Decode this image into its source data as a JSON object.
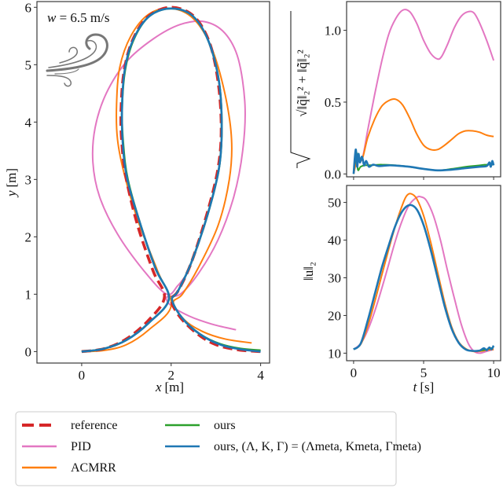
{
  "chart_data": [
    {
      "id": "trajectory",
      "type": "line",
      "title": "",
      "xlabel": "x [m]",
      "ylabel": "y [m]",
      "xlim": [
        -1.0,
        4.2
      ],
      "ylim": [
        -0.2,
        6.1
      ],
      "xticks": [
        0,
        2,
        4
      ],
      "yticks": [
        0,
        1,
        2,
        3,
        4,
        5,
        6
      ],
      "grid": false,
      "annotation": "w = 6.5 m/s",
      "annotation_icon": "wind-icon",
      "series": [
        {
          "name": "reference",
          "color": "#d62728",
          "dash": true,
          "x": [
            0.0,
            0.5,
            1.0,
            1.5,
            1.85,
            1.6,
            1.25,
            1.0,
            0.9,
            0.88,
            0.95,
            1.15,
            1.5,
            2.0,
            2.5,
            2.85,
            3.05,
            3.12,
            3.05,
            2.8,
            2.45,
            2.15,
            2.0,
            2.2,
            2.6,
            3.0,
            3.5,
            4.0
          ],
          "y": [
            0.0,
            0.05,
            0.22,
            0.55,
            0.95,
            1.4,
            2.2,
            3.0,
            3.6,
            4.2,
            4.9,
            5.45,
            5.85,
            6.0,
            5.85,
            5.4,
            4.7,
            3.9,
            3.2,
            2.4,
            1.55,
            1.05,
            0.9,
            0.6,
            0.3,
            0.12,
            0.03,
            0.0
          ]
        },
        {
          "name": "PID",
          "color": "#e377c2",
          "dash": false,
          "x": [
            2.35,
            2.15,
            1.9,
            1.4,
            0.8,
            0.4,
            0.25,
            0.3,
            0.55,
            1.0,
            1.6,
            2.2,
            2.75,
            3.2,
            3.5,
            3.65,
            3.6,
            3.4,
            3.05,
            2.6,
            2.2,
            1.9,
            2.0,
            2.4,
            2.9,
            3.45
          ],
          "y": [
            1.35,
            1.15,
            1.0,
            1.4,
            2.05,
            2.7,
            3.3,
            3.9,
            4.5,
            5.05,
            5.45,
            5.7,
            5.75,
            5.55,
            5.1,
            4.3,
            3.5,
            2.7,
            1.95,
            1.35,
            1.0,
            0.95,
            0.8,
            0.62,
            0.48,
            0.38
          ]
        },
        {
          "name": "ACMRR",
          "color": "#ff7f0e",
          "dash": false,
          "x": [
            0.0,
            0.5,
            1.0,
            1.5,
            2.0,
            1.7,
            1.25,
            0.95,
            0.8,
            0.78,
            0.85,
            1.1,
            1.5,
            2.0,
            2.5,
            2.9,
            3.2,
            3.35,
            3.3,
            3.05,
            2.6,
            2.25,
            2.05,
            2.3,
            2.7,
            3.2,
            3.8
          ],
          "y": [
            0.0,
            0.02,
            0.12,
            0.38,
            0.8,
            1.4,
            2.3,
            3.1,
            3.7,
            4.3,
            4.95,
            5.5,
            5.88,
            5.98,
            5.8,
            5.3,
            4.5,
            3.7,
            3.0,
            2.2,
            1.45,
            1.0,
            0.85,
            0.55,
            0.35,
            0.22,
            0.15
          ]
        },
        {
          "name": "ours",
          "color": "#2ca02c",
          "dash": false,
          "x": [
            0.0,
            0.5,
            1.0,
            1.5,
            1.95,
            1.65,
            1.3,
            1.03,
            0.93,
            0.9,
            0.97,
            1.17,
            1.52,
            2.0,
            2.48,
            2.84,
            3.07,
            3.13,
            3.07,
            2.82,
            2.45,
            2.15,
            2.02,
            2.25,
            2.65,
            3.1,
            3.55,
            4.0
          ],
          "y": [
            0.0,
            0.05,
            0.2,
            0.5,
            0.92,
            1.45,
            2.25,
            3.0,
            3.6,
            4.2,
            4.9,
            5.45,
            5.85,
            5.98,
            5.85,
            5.4,
            4.7,
            3.9,
            3.2,
            2.4,
            1.55,
            1.05,
            0.9,
            0.58,
            0.3,
            0.13,
            0.05,
            0.02
          ]
        },
        {
          "name": "ours, (Λ, K, Γ) = (Λmeta, Kmeta, Γmeta)",
          "color": "#1f77b4",
          "dash": false,
          "x": [
            0.0,
            0.5,
            1.0,
            1.5,
            1.95,
            1.65,
            1.3,
            1.02,
            0.92,
            0.9,
            0.96,
            1.16,
            1.52,
            2.0,
            2.48,
            2.84,
            3.07,
            3.13,
            3.07,
            2.82,
            2.45,
            2.15,
            2.02,
            2.25,
            2.65,
            3.1,
            3.55,
            4.0
          ],
          "y": [
            0.0,
            0.05,
            0.2,
            0.5,
            0.92,
            1.45,
            2.25,
            3.0,
            3.6,
            4.2,
            4.9,
            5.45,
            5.85,
            5.98,
            5.85,
            5.4,
            4.7,
            3.9,
            3.2,
            2.4,
            1.55,
            1.05,
            0.9,
            0.58,
            0.3,
            0.12,
            0.04,
            0.0
          ]
        }
      ]
    },
    {
      "id": "tracking-error",
      "type": "line",
      "xlabel": "",
      "ylabel": "√(‖q̃‖₂² + ‖q̃̇‖₂²)",
      "xlim": [
        -0.5,
        10.5
      ],
      "ylim": [
        -0.02,
        1.2
      ],
      "xticks": [
        0,
        5,
        10
      ],
      "xticklabels_visible": false,
      "yticks": [
        0.0,
        0.5,
        1.0
      ],
      "yticklabels": [
        "0.0",
        "0.5",
        "1.0"
      ],
      "grid": false,
      "series": [
        {
          "name": "PID",
          "color": "#e377c2",
          "x": [
            0.0,
            0.3,
            0.6,
            1.0,
            1.5,
            2.0,
            2.5,
            3.0,
            3.5,
            4.0,
            4.5,
            5.0,
            5.5,
            6.0,
            6.3,
            6.7,
            7.2,
            7.7,
            8.2,
            8.6,
            9.0,
            9.5,
            10.0
          ],
          "y": [
            0.0,
            0.12,
            0.1,
            0.3,
            0.55,
            0.78,
            0.97,
            1.08,
            1.14,
            1.13,
            1.05,
            0.93,
            0.84,
            0.8,
            0.82,
            0.9,
            1.02,
            1.1,
            1.13,
            1.12,
            1.05,
            0.93,
            0.79
          ]
        },
        {
          "name": "ACMRR",
          "color": "#ff7f0e",
          "x": [
            0.0,
            0.3,
            0.6,
            1.0,
            1.5,
            2.0,
            2.5,
            3.0,
            3.5,
            4.0,
            4.5,
            5.0,
            5.5,
            6.0,
            6.5,
            7.0,
            7.5,
            8.0,
            8.5,
            9.0,
            9.5,
            10.0
          ],
          "y": [
            0.0,
            0.12,
            0.1,
            0.25,
            0.38,
            0.47,
            0.51,
            0.52,
            0.48,
            0.39,
            0.28,
            0.2,
            0.17,
            0.17,
            0.2,
            0.24,
            0.28,
            0.3,
            0.3,
            0.29,
            0.27,
            0.26
          ]
        },
        {
          "name": "ours",
          "color": "#2ca02c",
          "x": [
            0.0,
            0.2,
            0.3,
            0.5,
            0.8,
            1.0,
            1.5,
            2.0,
            3.0,
            4.0,
            5.0,
            6.0,
            7.0,
            8.0,
            9.0,
            9.5,
            10.0
          ],
          "y": [
            0.0,
            0.15,
            0.03,
            0.05,
            0.06,
            0.06,
            0.062,
            0.065,
            0.06,
            0.05,
            0.035,
            0.025,
            0.035,
            0.05,
            0.06,
            0.065,
            0.065
          ]
        },
        {
          "name": "ours, (Λ, K, Γ) = (Λmeta, Kmeta, Γmeta)",
          "color": "#1f77b4",
          "x": [
            0.0,
            0.15,
            0.25,
            0.35,
            0.45,
            0.6,
            0.75,
            0.9,
            1.1,
            1.4,
            1.8,
            2.5,
            3.0,
            4.0,
            5.0,
            6.0,
            7.0,
            8.0,
            9.0,
            9.5,
            9.7,
            9.8,
            9.9,
            10.0
          ],
          "y": [
            0.0,
            0.17,
            0.05,
            0.14,
            0.08,
            0.12,
            0.06,
            0.09,
            0.05,
            0.065,
            0.055,
            0.06,
            0.058,
            0.05,
            0.035,
            0.025,
            0.03,
            0.04,
            0.05,
            0.055,
            0.08,
            0.05,
            0.09,
            0.06
          ]
        }
      ]
    },
    {
      "id": "control-norm",
      "type": "line",
      "xlabel": "t [s]",
      "ylabel": "‖u‖₂",
      "xlim": [
        -0.5,
        10.5
      ],
      "ylim": [
        8,
        54.5
      ],
      "xticks": [
        0,
        5,
        10
      ],
      "yticks": [
        10,
        20,
        30,
        40,
        50
      ],
      "grid": false,
      "series": [
        {
          "name": "PID",
          "color": "#e377c2",
          "x": [
            0.0,
            0.5,
            1.0,
            1.5,
            2.0,
            2.5,
            3.0,
            3.5,
            4.0,
            4.5,
            4.8,
            5.2,
            5.7,
            6.2,
            6.7,
            7.2,
            7.7,
            8.2,
            8.6,
            9.0,
            9.5,
            10.0
          ],
          "y": [
            11.0,
            12.5,
            16.0,
            21.0,
            27.0,
            33.5,
            40.0,
            45.5,
            49.5,
            51.3,
            51.5,
            50.5,
            46.5,
            40.0,
            32.0,
            24.5,
            17.5,
            12.5,
            10.5,
            10.0,
            10.5,
            11.0
          ]
        },
        {
          "name": "ACMRR",
          "color": "#ff7f0e",
          "x": [
            0.0,
            0.5,
            1.0,
            1.5,
            2.0,
            2.5,
            3.0,
            3.5,
            3.8,
            4.1,
            4.5,
            5.0,
            5.5,
            6.0,
            6.5,
            7.0,
            7.5,
            8.0,
            8.5,
            9.0,
            9.5,
            10.0
          ],
          "y": [
            11.0,
            12.3,
            17.0,
            23.5,
            30.5,
            37.5,
            44.0,
            49.5,
            51.8,
            52.3,
            51.0,
            46.5,
            39.5,
            31.5,
            23.5,
            17.0,
            13.0,
            11.2,
            10.5,
            10.5,
            10.8,
            11.0
          ]
        },
        {
          "name": "ours",
          "color": "#2ca02c",
          "x": [
            0.0,
            0.5,
            1.0,
            1.5,
            2.0,
            2.5,
            3.0,
            3.5,
            4.0,
            4.5,
            5.0,
            5.5,
            6.0,
            6.5,
            7.0,
            7.5,
            8.0,
            8.5,
            9.0,
            9.5,
            10.0
          ],
          "y": [
            11.0,
            12.5,
            18.5,
            25.5,
            32.5,
            38.5,
            44.0,
            47.8,
            49.3,
            48.2,
            44.0,
            37.5,
            30.0,
            22.5,
            16.5,
            12.8,
            11.0,
            10.6,
            10.7,
            11.0,
            11.5
          ]
        },
        {
          "name": "ours, (Λ, K, Γ) = (Λmeta, Kmeta, Γmeta)",
          "color": "#1f77b4",
          "x": [
            0.0,
            0.5,
            1.0,
            1.5,
            2.0,
            2.5,
            3.0,
            3.5,
            4.0,
            4.5,
            5.0,
            5.5,
            6.0,
            6.5,
            7.0,
            7.5,
            8.0,
            8.5,
            9.0,
            9.3,
            9.5,
            9.7,
            9.85,
            10.0
          ],
          "y": [
            11.0,
            12.5,
            18.5,
            25.5,
            32.5,
            38.5,
            44.0,
            47.8,
            49.3,
            48.2,
            44.0,
            37.5,
            30.0,
            22.5,
            16.5,
            12.8,
            11.0,
            10.6,
            10.7,
            11.3,
            10.8,
            11.5,
            11.0,
            12.0
          ]
        }
      ]
    }
  ],
  "legend": {
    "placement": "bottom",
    "columns": 2,
    "entries": [
      {
        "label": "reference",
        "color": "#d62728",
        "dash": true
      },
      {
        "label": "PID",
        "color": "#e377c2",
        "dash": false
      },
      {
        "label": "ACMRR",
        "color": "#ff7f0e",
        "dash": false
      },
      {
        "label": "ours",
        "color": "#2ca02c",
        "dash": false
      },
      {
        "label": "ours, (Λ, K, Γ) = (Λmeta, Kmeta, Γmeta)",
        "color": "#1f77b4",
        "dash": false
      }
    ]
  },
  "labels": {
    "wind": "w = 6.5 m/s",
    "left_xlabel_var": "x",
    "left_xlabel_unit": "[m]",
    "left_ylabel_var": "y",
    "left_ylabel_unit": "[m]",
    "right_xlabel_var": "t",
    "right_xlabel_unit": "[s]",
    "top_ylabel": "√‖q̃‖₂² + ‖q̃̇‖₂²",
    "bottom_ylabel": "‖u‖₂"
  }
}
